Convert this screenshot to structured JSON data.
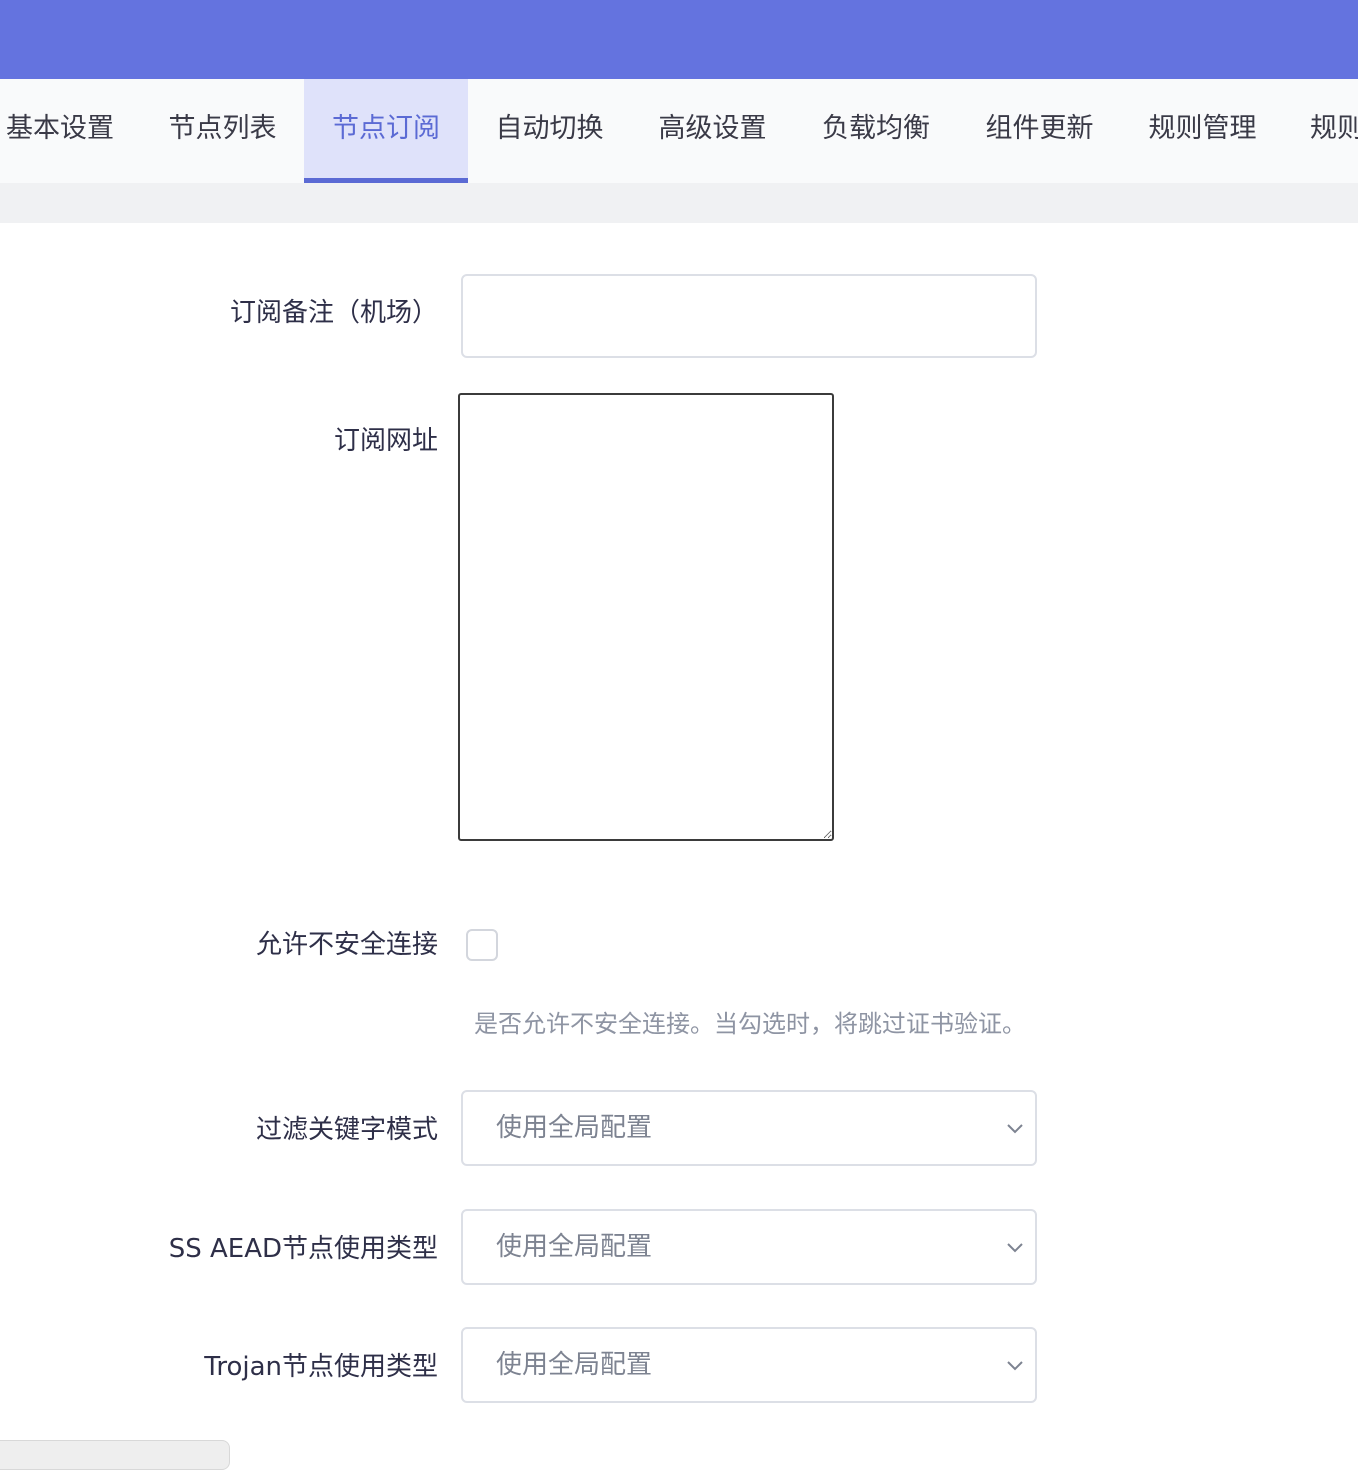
{
  "tabs": [
    {
      "label": "基本设置",
      "active": false
    },
    {
      "label": "节点列表",
      "active": false
    },
    {
      "label": "节点订阅",
      "active": true
    },
    {
      "label": "自动切换",
      "active": false
    },
    {
      "label": "高级设置",
      "active": false
    },
    {
      "label": "负载均衡",
      "active": false
    },
    {
      "label": "组件更新",
      "active": false
    },
    {
      "label": "规则管理",
      "active": false
    },
    {
      "label": "规则",
      "active": false
    }
  ],
  "form": {
    "remark": {
      "label": "订阅备注（机场）",
      "value": ""
    },
    "url": {
      "label": "订阅网址",
      "value": ""
    },
    "insecure": {
      "label": "允许不安全连接",
      "checked": false,
      "hint": "是否允许不安全连接。当勾选时，将跳过证书验证。"
    },
    "filter_mode": {
      "label": "过滤关键字模式",
      "value": "使用全局配置"
    },
    "ss_aead": {
      "label": "SS AEAD节点使用类型",
      "value": "使用全局配置"
    },
    "trojan": {
      "label": "Trojan节点使用类型",
      "value": "使用全局配置"
    }
  },
  "colors": {
    "header": "#6473df",
    "accent": "#5b6ad4",
    "active_tab_bg": "#dfe2fa"
  }
}
